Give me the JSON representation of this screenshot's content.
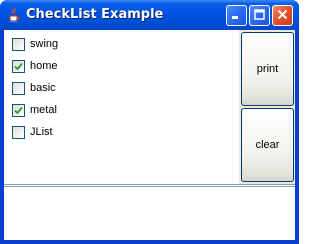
{
  "window": {
    "title": "CheckList Example",
    "icons": {
      "app": "java-cup-icon",
      "minimize": "minimize-icon",
      "maximize": "maximize-icon",
      "close": "close-icon"
    }
  },
  "checklist": {
    "items": [
      {
        "label": "swing",
        "checked": false
      },
      {
        "label": "home",
        "checked": true
      },
      {
        "label": "basic",
        "checked": false
      },
      {
        "label": "metal",
        "checked": true
      },
      {
        "label": "JList",
        "checked": false
      }
    ]
  },
  "buttons": {
    "print_label": "print",
    "clear_label": "clear"
  },
  "output": {
    "text": ""
  },
  "colors": {
    "titlebar": "#0054e3",
    "check": "#21a121",
    "button_border": "#003c74"
  }
}
